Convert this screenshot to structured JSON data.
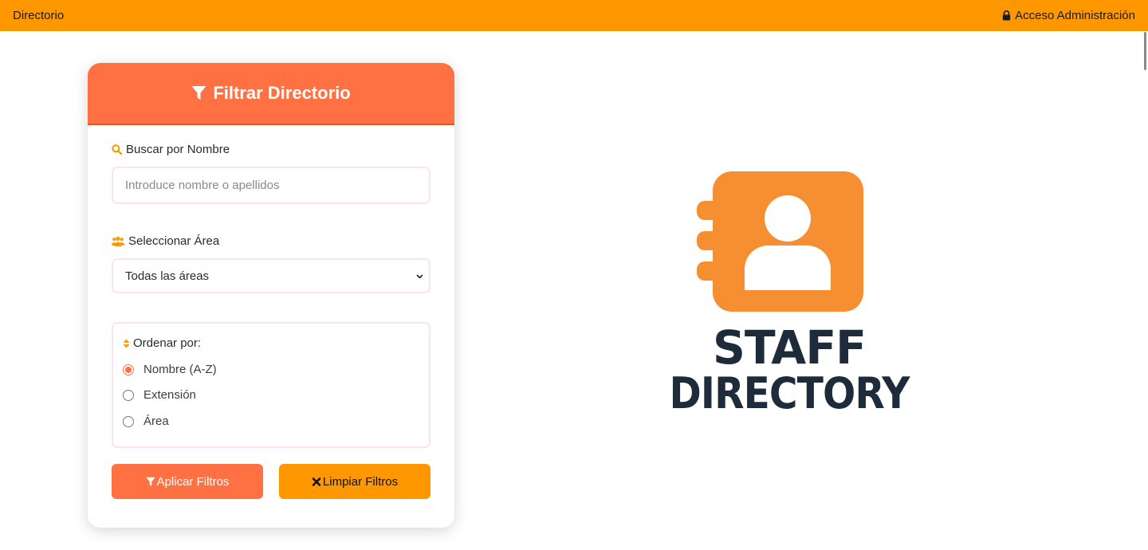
{
  "topbar": {
    "brand": "Directorio",
    "admin_label": "Acceso Administración",
    "accent_color": "#ff9800"
  },
  "filter_card": {
    "title": "Filtrar Directorio",
    "header_color": "#ff7043",
    "search": {
      "label": "Buscar por Nombre",
      "placeholder": "Introduce nombre o apellidos",
      "value": ""
    },
    "area": {
      "label": "Seleccionar Área",
      "selected": "Todas las áreas"
    },
    "sort": {
      "label": "Ordenar por:",
      "options": [
        {
          "label": "Nombre (A-Z)",
          "checked": true
        },
        {
          "label": "Extensión",
          "checked": false
        },
        {
          "label": "Área",
          "checked": false
        }
      ]
    },
    "buttons": {
      "apply": "Aplicar Filtros",
      "clear": "Limpiar Filtros"
    }
  },
  "logo": {
    "icon": "address-book-icon",
    "line1": "STAFF",
    "line2": "DIRECTORY",
    "icon_color": "#f68e32",
    "text_color": "#1d2b3a"
  }
}
